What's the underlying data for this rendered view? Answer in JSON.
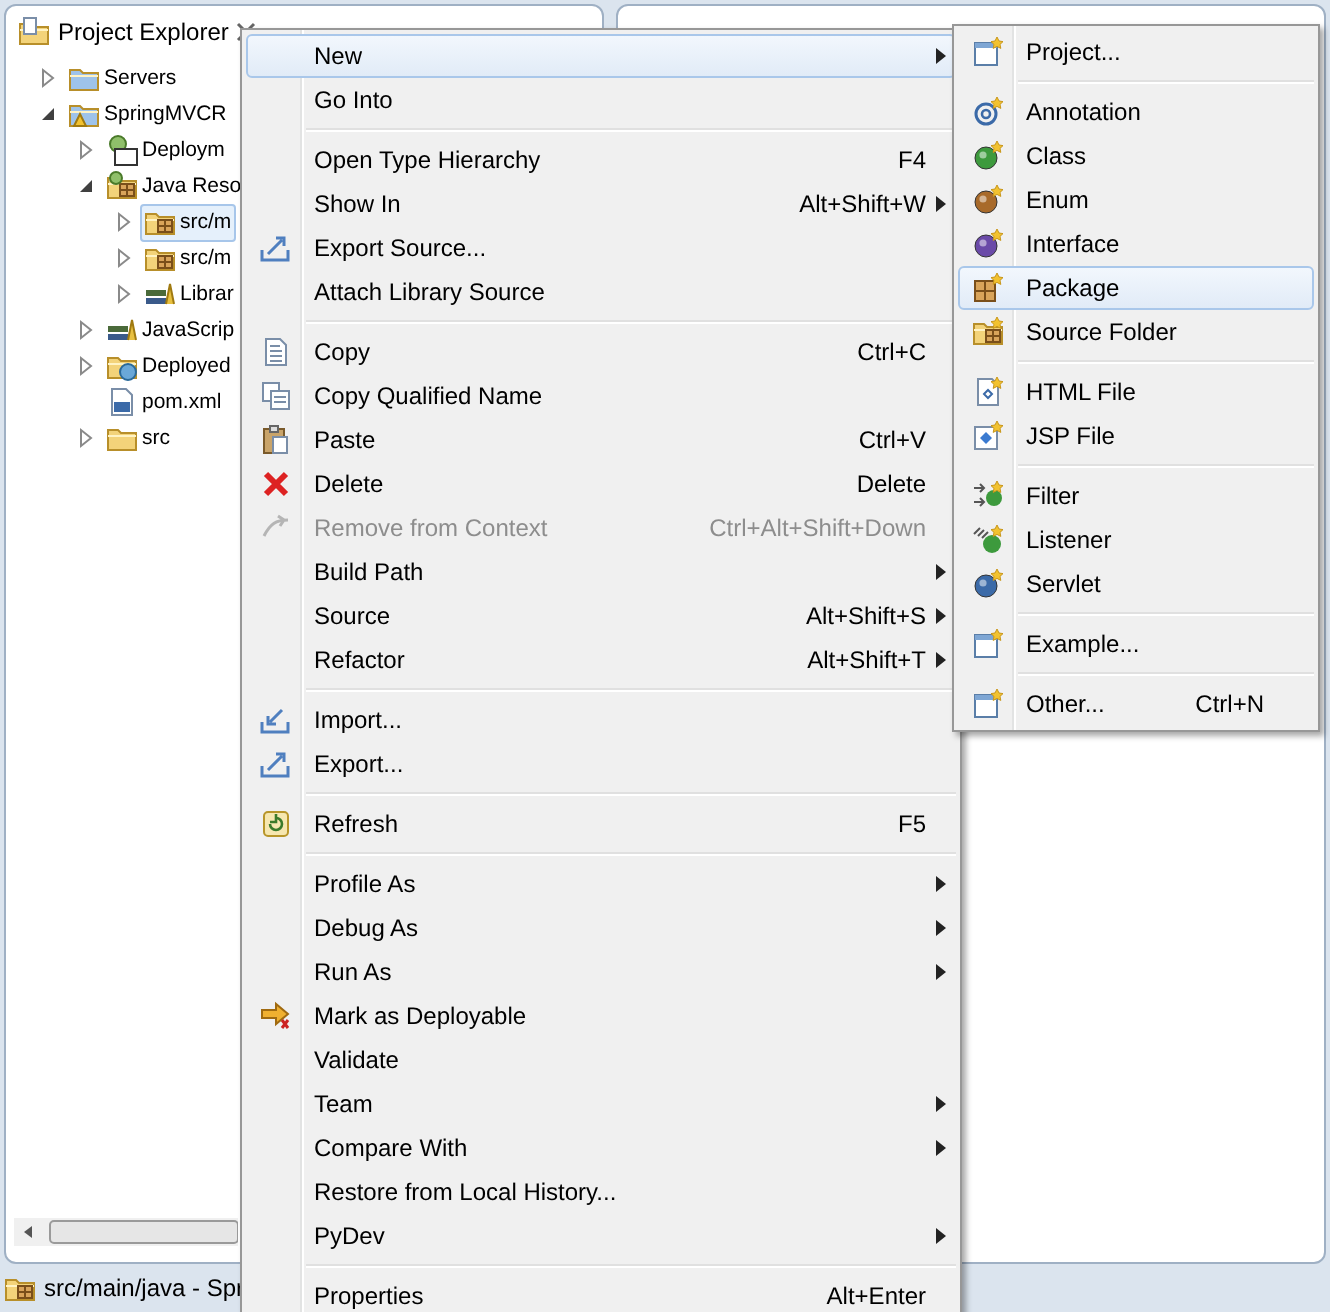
{
  "view": {
    "title": "Project Explorer"
  },
  "tree": [
    {
      "label": "Servers",
      "expandable": true,
      "expanded": false,
      "selected": false
    },
    {
      "label": "SpringMVCR",
      "expandable": true,
      "expanded": true,
      "selected": false,
      "children": [
        {
          "label": "Deploym",
          "expandable": true,
          "expanded": false,
          "selected": false
        },
        {
          "label": "Java Reso",
          "expandable": true,
          "expanded": true,
          "selected": false,
          "children": [
            {
              "label": "src/m",
              "expandable": true,
              "expanded": false,
              "selected": true
            },
            {
              "label": "src/m",
              "expandable": true,
              "expanded": false,
              "selected": false
            },
            {
              "label": "Librar",
              "expandable": true,
              "expanded": false,
              "selected": false
            }
          ]
        },
        {
          "label": "JavaScrip",
          "expandable": true,
          "expanded": false,
          "selected": false
        },
        {
          "label": "Deployed",
          "expandable": true,
          "expanded": false,
          "selected": false
        },
        {
          "label": "pom.xml",
          "expandable": false,
          "selected": false
        },
        {
          "label": "src",
          "expandable": true,
          "expanded": false,
          "selected": false
        }
      ]
    }
  ],
  "status_bar": {
    "text": "src/main/java - Spr"
  },
  "context_menu": {
    "items": [
      {
        "kind": "item",
        "label": "New",
        "has_submenu": true,
        "selected": true,
        "disabled": false
      },
      {
        "kind": "item",
        "label": "Go Into",
        "has_submenu": false,
        "selected": false,
        "disabled": false
      },
      {
        "kind": "separator"
      },
      {
        "kind": "item",
        "label": "Open Type Hierarchy",
        "shortcut": "F4",
        "has_submenu": false,
        "selected": false,
        "disabled": false
      },
      {
        "kind": "item",
        "label": "Show In",
        "shortcut": "Alt+Shift+W",
        "has_submenu": true,
        "selected": false,
        "disabled": false
      },
      {
        "kind": "item",
        "label": "Export Source...",
        "has_submenu": false,
        "selected": false,
        "disabled": false
      },
      {
        "kind": "item",
        "label": "Attach Library Source",
        "has_submenu": false,
        "selected": false,
        "disabled": false
      },
      {
        "kind": "separator"
      },
      {
        "kind": "item",
        "label": "Copy",
        "shortcut": "Ctrl+C",
        "has_submenu": false,
        "selected": false,
        "disabled": false
      },
      {
        "kind": "item",
        "label": "Copy Qualified Name",
        "has_submenu": false,
        "selected": false,
        "disabled": false
      },
      {
        "kind": "item",
        "label": "Paste",
        "shortcut": "Ctrl+V",
        "has_submenu": false,
        "selected": false,
        "disabled": false
      },
      {
        "kind": "item",
        "label": "Delete",
        "shortcut": "Delete",
        "has_submenu": false,
        "selected": false,
        "disabled": false
      },
      {
        "kind": "item",
        "label": "Remove from Context",
        "shortcut": "Ctrl+Alt+Shift+Down",
        "has_submenu": false,
        "selected": false,
        "disabled": true
      },
      {
        "kind": "item",
        "label": "Build Path",
        "has_submenu": true,
        "selected": false,
        "disabled": false
      },
      {
        "kind": "item",
        "label": "Source",
        "shortcut": "Alt+Shift+S",
        "has_submenu": true,
        "selected": false,
        "disabled": false
      },
      {
        "kind": "item",
        "label": "Refactor",
        "shortcut": "Alt+Shift+T",
        "has_submenu": true,
        "selected": false,
        "disabled": false
      },
      {
        "kind": "separator"
      },
      {
        "kind": "item",
        "label": "Import...",
        "has_submenu": false,
        "selected": false,
        "disabled": false
      },
      {
        "kind": "item",
        "label": "Export...",
        "has_submenu": false,
        "selected": false,
        "disabled": false
      },
      {
        "kind": "separator"
      },
      {
        "kind": "item",
        "label": "Refresh",
        "shortcut": "F5",
        "has_submenu": false,
        "selected": false,
        "disabled": false
      },
      {
        "kind": "separator"
      },
      {
        "kind": "item",
        "label": "Profile As",
        "has_submenu": true,
        "selected": false,
        "disabled": false
      },
      {
        "kind": "item",
        "label": "Debug As",
        "has_submenu": true,
        "selected": false,
        "disabled": false
      },
      {
        "kind": "item",
        "label": "Run As",
        "has_submenu": true,
        "selected": false,
        "disabled": false
      },
      {
        "kind": "item",
        "label": "Mark as Deployable",
        "has_submenu": false,
        "selected": false,
        "disabled": false
      },
      {
        "kind": "item",
        "label": "Validate",
        "has_submenu": false,
        "selected": false,
        "disabled": false
      },
      {
        "kind": "item",
        "label": "Team",
        "has_submenu": true,
        "selected": false,
        "disabled": false
      },
      {
        "kind": "item",
        "label": "Compare With",
        "has_submenu": true,
        "selected": false,
        "disabled": false
      },
      {
        "kind": "item",
        "label": "Restore from Local History...",
        "has_submenu": false,
        "selected": false,
        "disabled": false
      },
      {
        "kind": "item",
        "label": "PyDev",
        "has_submenu": true,
        "selected": false,
        "disabled": false
      },
      {
        "kind": "separator"
      },
      {
        "kind": "item",
        "label": "Properties",
        "shortcut": "Alt+Enter",
        "has_submenu": false,
        "selected": false,
        "disabled": false
      }
    ]
  },
  "submenu": {
    "items": [
      {
        "kind": "item",
        "label": "Project...",
        "has_submenu": false,
        "selected": false,
        "disabled": false
      },
      {
        "kind": "separator"
      },
      {
        "kind": "item",
        "label": "Annotation",
        "has_submenu": false,
        "selected": false,
        "disabled": false
      },
      {
        "kind": "item",
        "label": "Class",
        "has_submenu": false,
        "selected": false,
        "disabled": false
      },
      {
        "kind": "item",
        "label": "Enum",
        "has_submenu": false,
        "selected": false,
        "disabled": false
      },
      {
        "kind": "item",
        "label": "Interface",
        "has_submenu": false,
        "selected": false,
        "disabled": false
      },
      {
        "kind": "item",
        "label": "Package",
        "has_submenu": false,
        "selected": true,
        "disabled": false
      },
      {
        "kind": "item",
        "label": "Source Folder",
        "has_submenu": false,
        "selected": false,
        "disabled": false
      },
      {
        "kind": "separator"
      },
      {
        "kind": "item",
        "label": "HTML File",
        "has_submenu": false,
        "selected": false,
        "disabled": false
      },
      {
        "kind": "item",
        "label": "JSP File",
        "has_submenu": false,
        "selected": false,
        "disabled": false
      },
      {
        "kind": "separator"
      },
      {
        "kind": "item",
        "label": "Filter",
        "has_submenu": false,
        "selected": false,
        "disabled": false
      },
      {
        "kind": "item",
        "label": "Listener",
        "has_submenu": false,
        "selected": false,
        "disabled": false
      },
      {
        "kind": "item",
        "label": "Servlet",
        "has_submenu": false,
        "selected": false,
        "disabled": false
      },
      {
        "kind": "separator"
      },
      {
        "kind": "item",
        "label": "Example...",
        "has_submenu": false,
        "selected": false,
        "disabled": false
      },
      {
        "kind": "separator"
      },
      {
        "kind": "item",
        "label": "Other...",
        "shortcut": "Ctrl+N",
        "has_submenu": false,
        "selected": false,
        "disabled": false
      }
    ]
  }
}
